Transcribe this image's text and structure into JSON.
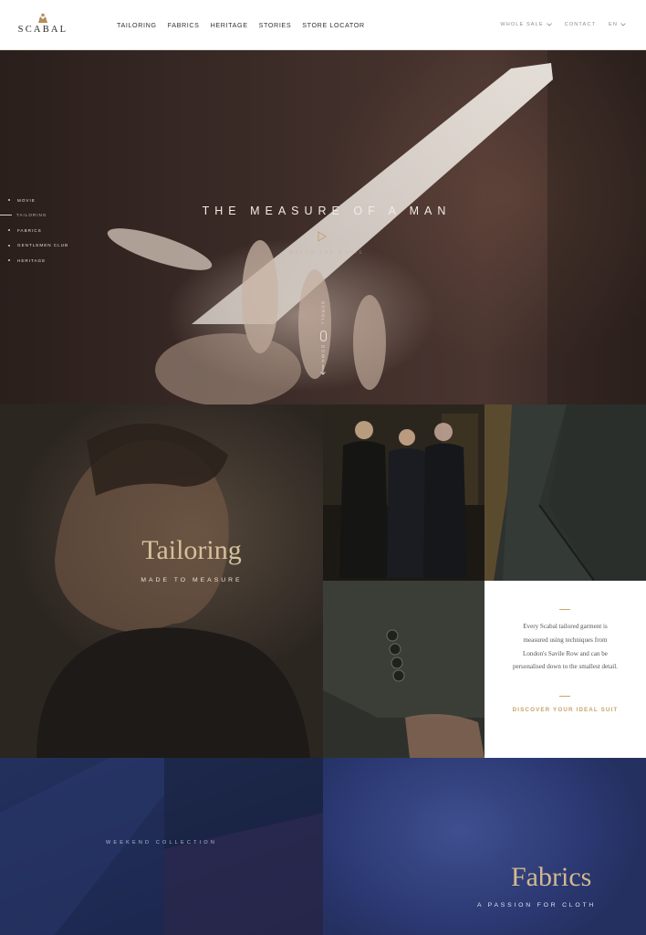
{
  "header": {
    "brand": "SCABAL",
    "nav": [
      "TAILORING",
      "FABRICS",
      "HERITAGE",
      "STORIES",
      "STORE LOCATOR"
    ],
    "right": {
      "wholesale": "WHOLE SALE",
      "contact": "CONTACT",
      "lang": "EN"
    }
  },
  "hero": {
    "title": "THE MEASURE OF A MAN",
    "watch_label": "WATCH THE MOVIE",
    "scroll_top": "SCROLL",
    "scroll_bottom": "DOWN",
    "side_nav": [
      {
        "label": "MOVIE",
        "active": false
      },
      {
        "label": "TAILORING",
        "active": true
      },
      {
        "label": "FABRICS",
        "active": false
      },
      {
        "label": "GENTLEMEN CLUB",
        "active": false
      },
      {
        "label": "HERITAGE",
        "active": false
      }
    ]
  },
  "tailoring": {
    "title": "Tailoring",
    "subtitle": "MADE TO MEASURE",
    "body": "Every Scabal tailored garment is measured using techniques from London's Savile Row and can be personalised down to the smallest detail.",
    "cta": "DISCOVER YOUR IDEAL SUIT"
  },
  "fabrics": {
    "weekend_label": "WEEKEND COLLECTION",
    "title": "Fabrics",
    "subtitle": "A PASSION FOR CLOTH"
  },
  "colors": {
    "gold": "#c8a36b",
    "navy": "#2b3872",
    "hero_text": "#f2ece4"
  }
}
